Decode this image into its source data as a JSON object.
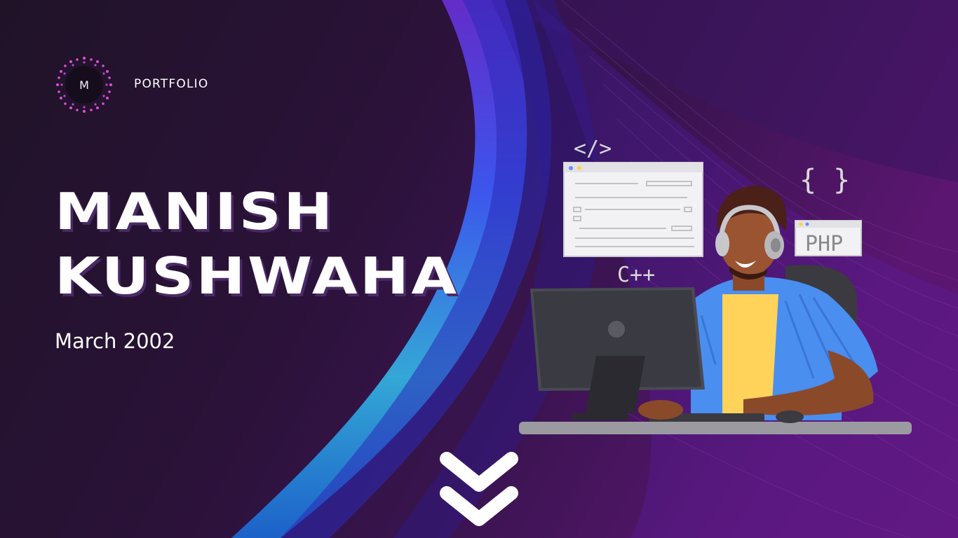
{
  "header": {
    "logo_letter": "M",
    "brand_label": "PORTFOLIO"
  },
  "hero": {
    "name_line_1": "MANISH",
    "name_line_2": "KUSHWAHA",
    "date": "March 2002"
  },
  "illustration": {
    "tag_html": "</>",
    "tag_braces": "{ }",
    "tag_php": "PHP",
    "tag_cpp": "C++"
  },
  "colors": {
    "background_dark": "#22122e",
    "accent_purple": "#7a2a9a",
    "accent_blue": "#2f5bff",
    "accent_cyan": "#3fd0e6",
    "logo_pink": "#e04ed0",
    "text_white": "#ffffff"
  },
  "icons": {
    "scroll": "double-chevron-down-icon"
  }
}
